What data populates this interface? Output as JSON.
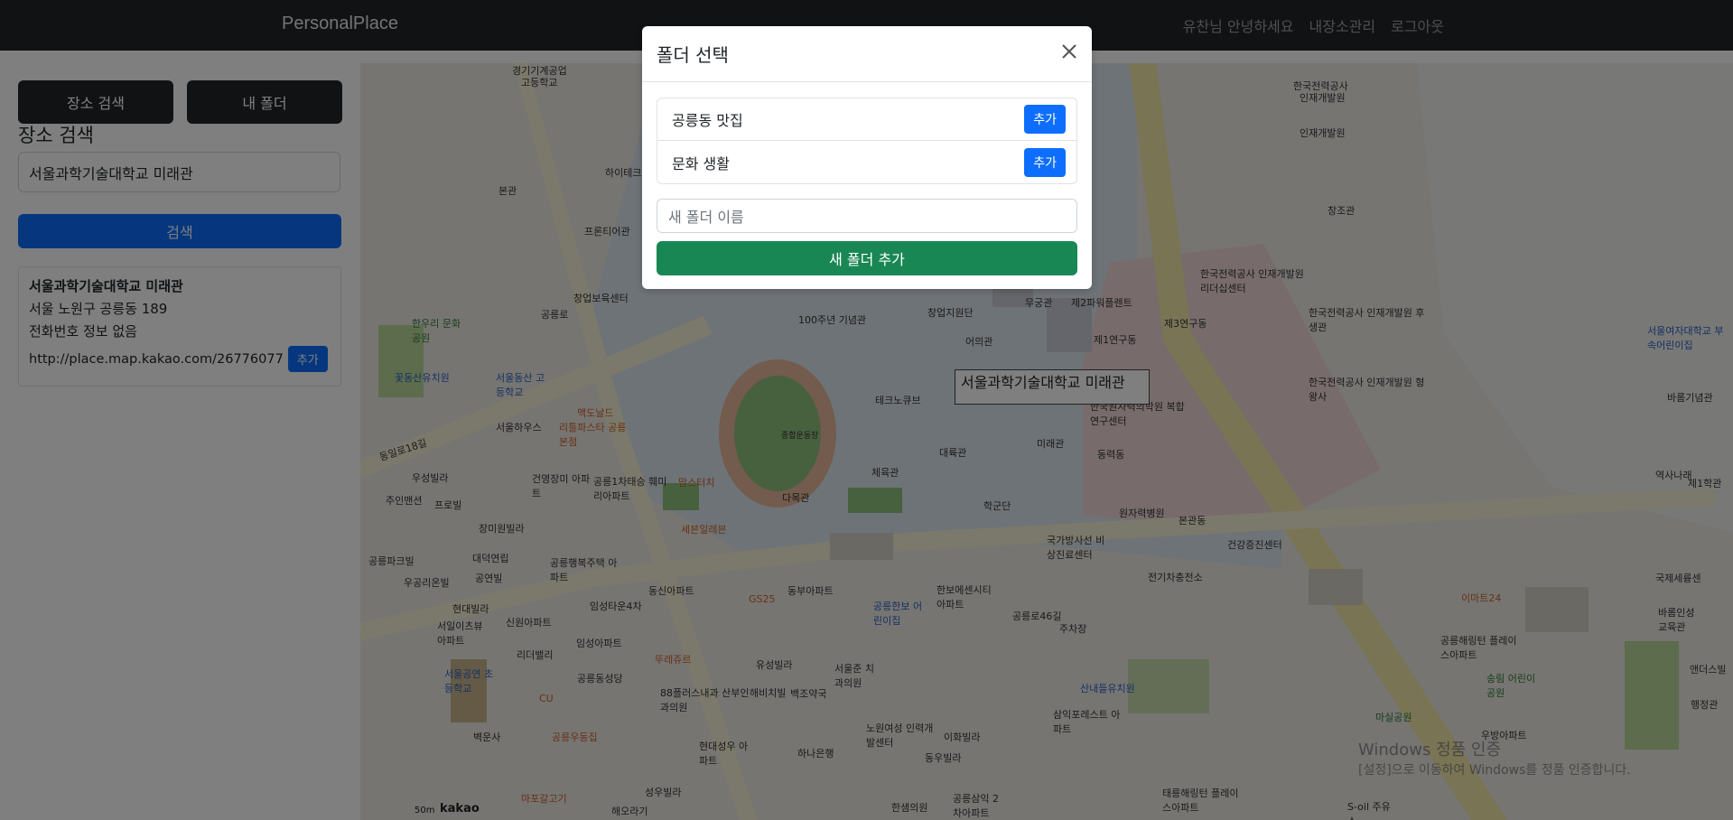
{
  "navbar": {
    "brand": "PersonalPlace",
    "greeting": "유찬님 안녕하세요",
    "manage_link": "내장소관리",
    "logout_link": "로그아웃"
  },
  "sidebar": {
    "tab_search": "장소 검색",
    "tab_folder": "내 폴더",
    "heading": "장소 검색",
    "search_value": "서울과학기술대학교 미래관",
    "search_button": "검색",
    "result": {
      "title": "서울과학기술대학교 미래관",
      "address": "서울 노원구 공릉동 189",
      "phone": "전화번호 정보 없음",
      "url": "http://place.map.kakao.com/26776077",
      "add_button": "추가"
    }
  },
  "map": {
    "marker_label": "서울과학기술대학교 미래관",
    "scale": "50m",
    "provider": "kakao",
    "labels": [
      {
        "text": "경기기계공업",
        "cls": ""
      },
      {
        "text": "고등학교",
        "cls": ""
      },
      {
        "text": "한국전력공사",
        "cls": ""
      },
      {
        "text": "인재개발원",
        "cls": ""
      },
      {
        "text": "창조관",
        "cls": ""
      },
      {
        "text": "하이테크관",
        "cls": ""
      },
      {
        "text": "본관",
        "cls": ""
      },
      {
        "text": "프론티어관",
        "cls": ""
      },
      {
        "text": "창업보육센터",
        "cls": ""
      },
      {
        "text": "공릉로",
        "cls": ""
      },
      {
        "text": "100주년 기념관",
        "cls": ""
      },
      {
        "text": "창업지원단",
        "cls": ""
      },
      {
        "text": "무궁관",
        "cls": ""
      },
      {
        "text": "제2파워플렌트",
        "cls": ""
      },
      {
        "text": "제1연구동",
        "cls": ""
      },
      {
        "text": "제3연구동",
        "cls": ""
      },
      {
        "text": "한국전력공사 인재개발원 리더십센터",
        "cls": ""
      },
      {
        "text": "한국전력공사 인재개발원 후생관",
        "cls": ""
      },
      {
        "text": "한국전력공사 인재개발원 형왕사",
        "cls": ""
      },
      {
        "text": "서울여자대학교 부속어린이집",
        "cls": "blue"
      },
      {
        "text": "바롬기념관",
        "cls": ""
      },
      {
        "text": "한우리 문화공원",
        "cls": "green"
      },
      {
        "text": "꽃동산유치원",
        "cls": "blue"
      },
      {
        "text": "서울동산 고등학교",
        "cls": "blue"
      },
      {
        "text": "맥도날드",
        "cls": "orange"
      },
      {
        "text": "서울하우스",
        "cls": ""
      },
      {
        "text": "리틀파스타 공릉본점",
        "cls": "orange"
      },
      {
        "text": "어의관",
        "cls": ""
      },
      {
        "text": "테크노큐브",
        "cls": ""
      },
      {
        "text": "종합운동장",
        "cls": ""
      },
      {
        "text": "한국원자력의학원 복합연구센터",
        "cls": ""
      },
      {
        "text": "미래관",
        "cls": ""
      },
      {
        "text": "동력동",
        "cls": ""
      },
      {
        "text": "역사나래",
        "cls": ""
      },
      {
        "text": "제1학관",
        "cls": ""
      },
      {
        "text": "동일로18길",
        "cls": ""
      },
      {
        "text": "우성빌라",
        "cls": ""
      },
      {
        "text": "건영장미 아파트",
        "cls": ""
      },
      {
        "text": "공릉1차태승 훼미리아파트",
        "cls": ""
      },
      {
        "text": "맘스터치",
        "cls": "orange"
      },
      {
        "text": "체육관",
        "cls": ""
      },
      {
        "text": "대륙관",
        "cls": ""
      },
      {
        "text": "주인맨션",
        "cls": ""
      },
      {
        "text": "프로빌",
        "cls": ""
      },
      {
        "text": "장미원빌라",
        "cls": ""
      },
      {
        "text": "다목관",
        "cls": ""
      },
      {
        "text": "학군단",
        "cls": ""
      },
      {
        "text": "원자력병원",
        "cls": ""
      },
      {
        "text": "본관동",
        "cls": ""
      },
      {
        "text": "세븐일레븐",
        "cls": "orange"
      },
      {
        "text": "국가방사선 비상진료센터",
        "cls": ""
      },
      {
        "text": "건강증진센터",
        "cls": ""
      },
      {
        "text": "대덕연립",
        "cls": ""
      },
      {
        "text": "공릉행복주택 아파트",
        "cls": ""
      },
      {
        "text": "공릉파크빌",
        "cls": ""
      },
      {
        "text": "우공리온빌",
        "cls": ""
      },
      {
        "text": "공연빌",
        "cls": ""
      },
      {
        "text": "동신아파트",
        "cls": ""
      },
      {
        "text": "동부아파트",
        "cls": ""
      },
      {
        "text": "한보에센시티 아파트",
        "cls": ""
      },
      {
        "text": "공릉한보 어린이집",
        "cls": "blue"
      },
      {
        "text": "전기차충전소",
        "cls": ""
      },
      {
        "text": "GS25",
        "cls": "orange"
      },
      {
        "text": "현대빌라",
        "cls": ""
      },
      {
        "text": "임성타운4차",
        "cls": ""
      },
      {
        "text": "서일이츠뷰 아파트",
        "cls": ""
      },
      {
        "text": "신원아파트",
        "cls": ""
      },
      {
        "text": "리더밸리",
        "cls": ""
      },
      {
        "text": "임성아파트",
        "cls": ""
      },
      {
        "text": "뚜레쥬르",
        "cls": "orange"
      },
      {
        "text": "유성빌라",
        "cls": ""
      },
      {
        "text": "서울공연 초등학교",
        "cls": "blue"
      },
      {
        "text": "공릉동성당",
        "cls": ""
      },
      {
        "text": "88플러스내과 산부인과의원",
        "cls": ""
      },
      {
        "text": "해비치빌",
        "cls": ""
      },
      {
        "text": "백조약국",
        "cls": ""
      },
      {
        "text": "서울준 치과의원",
        "cls": ""
      },
      {
        "text": "공릉로46길",
        "cls": ""
      },
      {
        "text": "주차장",
        "cls": ""
      },
      {
        "text": "산내들유치원",
        "cls": "blue"
      },
      {
        "text": "삼익포레스트 아파트",
        "cls": ""
      },
      {
        "text": "이마트24",
        "cls": "orange"
      },
      {
        "text": "공릉해링턴 플레이스아파트",
        "cls": ""
      },
      {
        "text": "송림 어린이공원",
        "cls": "green"
      },
      {
        "text": "우방아파트",
        "cls": ""
      },
      {
        "text": "마실공원",
        "cls": "green"
      },
      {
        "text": "벽운사",
        "cls": ""
      },
      {
        "text": "공릉우동집",
        "cls": "orange"
      },
      {
        "text": "현대성우 아파트",
        "cls": ""
      },
      {
        "text": "하나은행",
        "cls": ""
      },
      {
        "text": "노원여성 인력개발센터",
        "cls": ""
      },
      {
        "text": "이화빌라",
        "cls": ""
      },
      {
        "text": "동우빌라",
        "cls": ""
      },
      {
        "text": "마포갈고기",
        "cls": "orange"
      },
      {
        "text": "성우빌라",
        "cls": ""
      },
      {
        "text": "해오라기",
        "cls": ""
      },
      {
        "text": "한샘의원",
        "cls": ""
      },
      {
        "text": "공릉삼익 2차아파트",
        "cls": ""
      },
      {
        "text": "태릉해링턴 플레이스아파트",
        "cls": ""
      },
      {
        "text": "S-oil 주유소",
        "cls": ""
      },
      {
        "text": "국제세륭센",
        "cls": ""
      },
      {
        "text": "바롬인성 교육관",
        "cls": ""
      },
      {
        "text": "앤더스빌",
        "cls": ""
      },
      {
        "text": "행정관",
        "cls": ""
      },
      {
        "text": "CU",
        "cls": "orange"
      }
    ]
  },
  "watermark": {
    "line1": "Windows 정품 인증",
    "line2": "[설정]으로 이동하여 Windows를 정품 인증합니다."
  },
  "modal": {
    "title": "폴더 선택",
    "folders": [
      {
        "name": "공릉동 맛집",
        "add": "추가"
      },
      {
        "name": "문화 생활",
        "add": "추가"
      }
    ],
    "new_folder_placeholder": "새 폴더 이름",
    "new_folder_button": "새 폴더 추가"
  }
}
